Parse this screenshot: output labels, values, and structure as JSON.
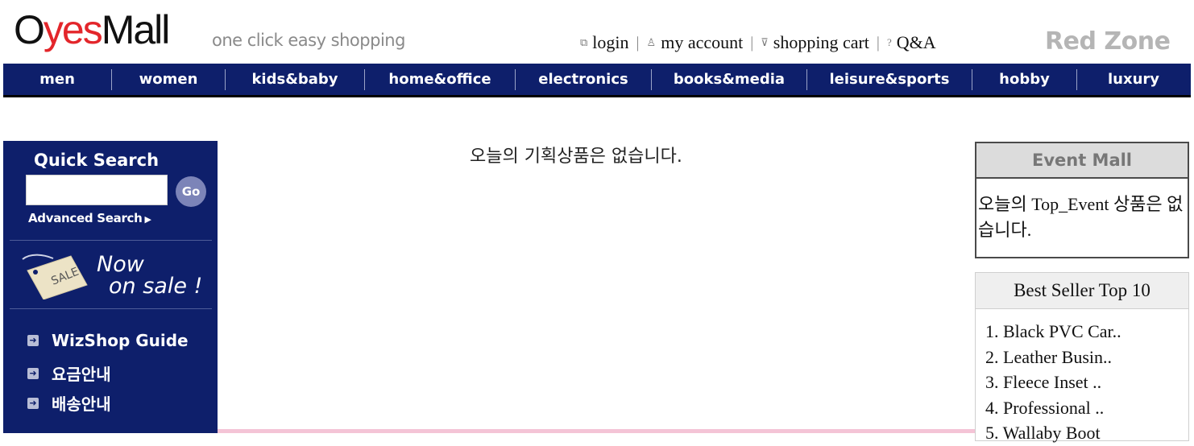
{
  "header": {
    "logo_part1": "O",
    "logo_accent": "yes",
    "logo_part2": "Mall",
    "tagline": "one click easy shopping",
    "links": {
      "login": "login",
      "my_account": "my account",
      "shopping_cart": "shopping cart",
      "qna": "Q&A"
    },
    "separator": "|",
    "red_zone": "Red Zone"
  },
  "nav": {
    "items": [
      "men",
      "women",
      "kids&baby",
      "home&office",
      "electronics",
      "books&media",
      "leisure&sports",
      "hobby",
      "luxury"
    ]
  },
  "sidebar": {
    "quick_search_title": "Quick Search",
    "search_value": "",
    "go_label": "Go",
    "advanced_search": "Advanced Search",
    "sale_tag_text": "SALE",
    "now_line": "Now",
    "on_sale_line": "on sale !",
    "guide_items": [
      "WizShop Guide",
      "요금안내",
      "배송안내"
    ]
  },
  "main": {
    "no_products_message": "오늘의 기획상품은 없습니다."
  },
  "event_mall": {
    "title": "Event Mall",
    "message": "오늘의 Top_Event 상품은 없습니다."
  },
  "best_seller": {
    "title": "Best Seller Top 10",
    "items": [
      "1. Black PVC Car..",
      "2. Leather Busin..",
      "3. Fleece Inset ..",
      "4. Professional ..",
      "5. Wallaby Boot"
    ]
  },
  "colors": {
    "nav_bg": "#0e1f6b",
    "logo_accent": "#e3262b",
    "red_zone": "#b5b5b5",
    "pink_line": "#f4c4d6"
  },
  "icons": {
    "login": "login-icon",
    "my_account": "person-icon",
    "shopping_cart": "cart-icon",
    "qna": "question-icon",
    "advanced": "triangle-right-icon",
    "guide_bullet": "arrow-right-icon"
  }
}
